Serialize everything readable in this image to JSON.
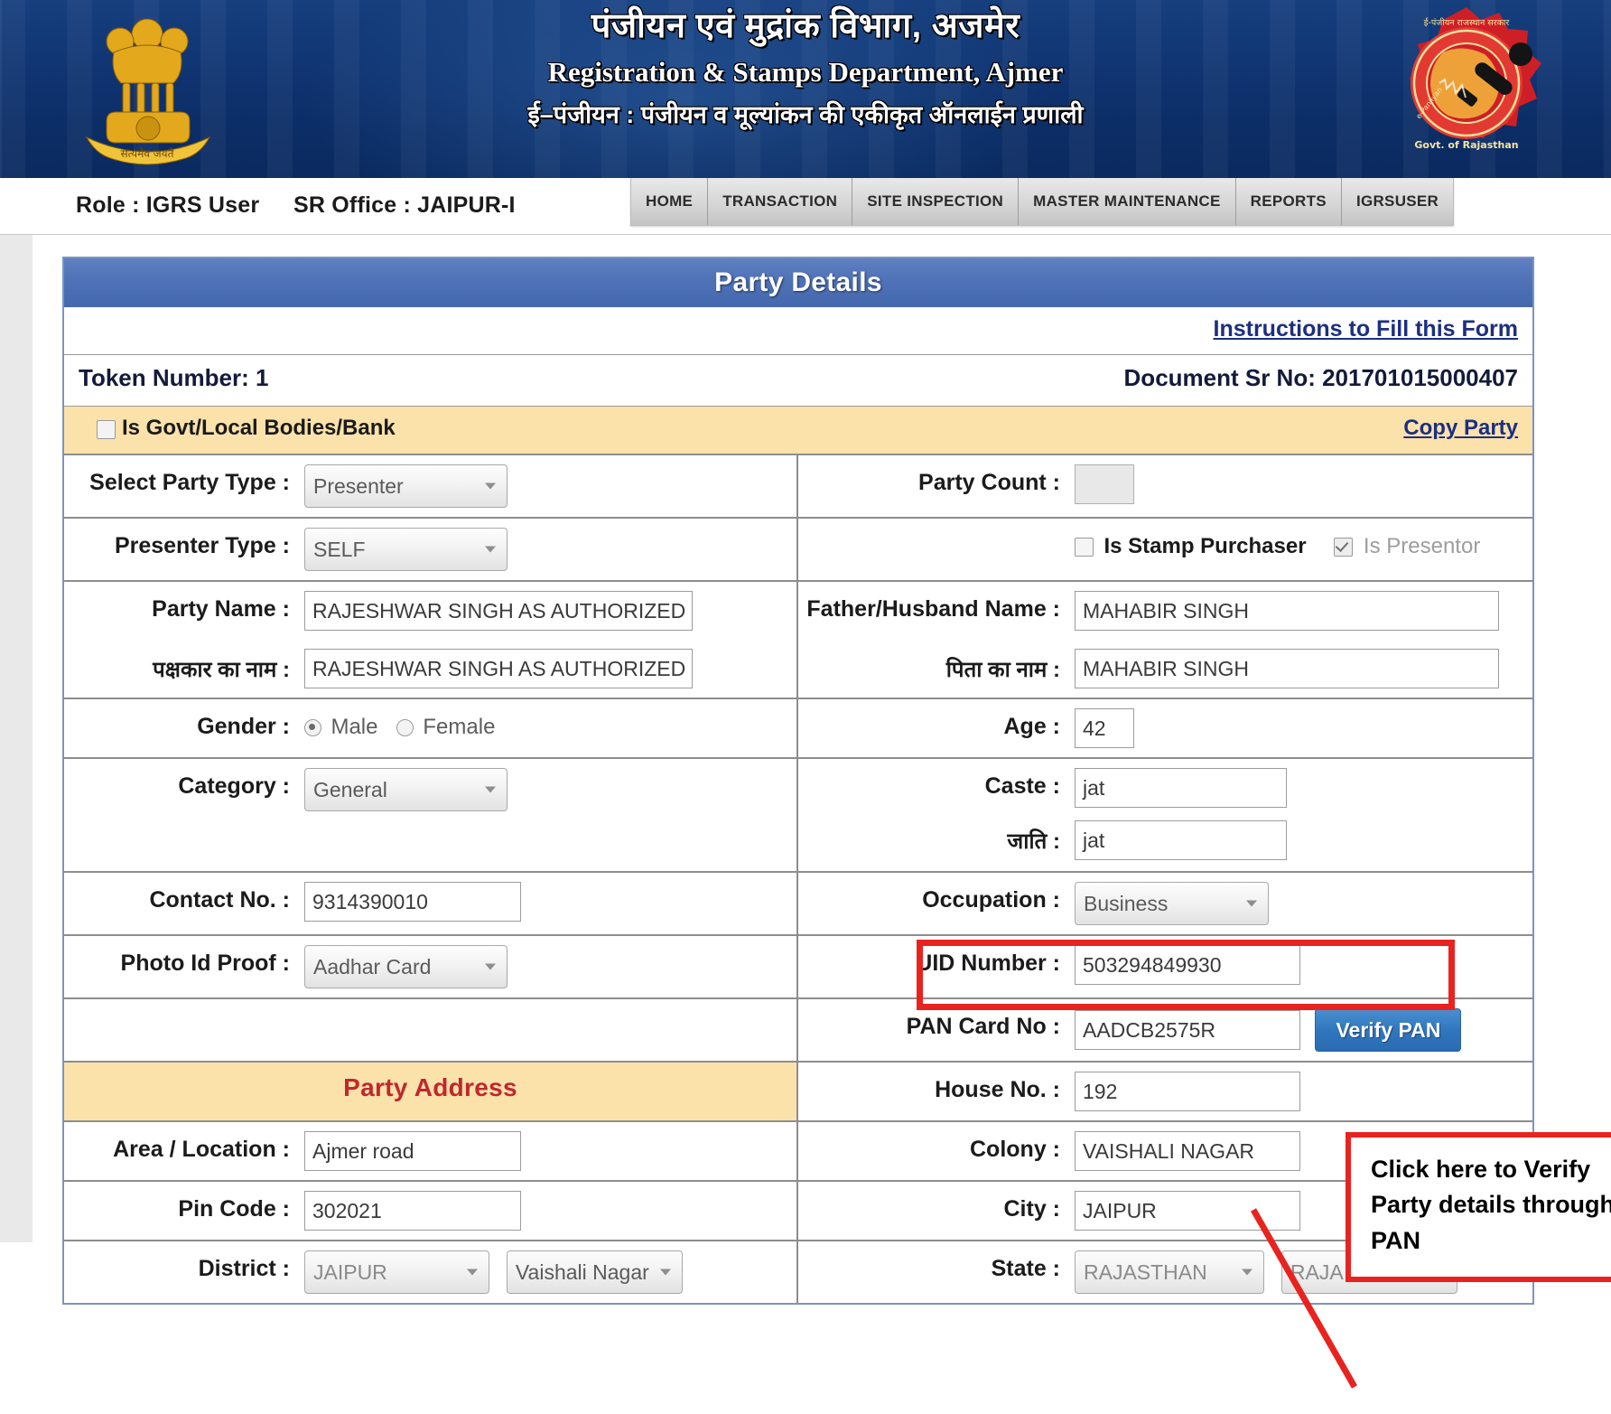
{
  "banner": {
    "title_hi": "पंजीयन एवं मुद्रांक विभाग, अजमेर",
    "title_en": "Registration & Stamps Department, Ajmer",
    "subtitle_hi": "ई–पंजीयन : पंजीयन व मूल्यांकन की एकीकृत ऑनलाईन प्रणाली",
    "emblem_icon": "ashoka-emblem-icon",
    "seal_icon": "rajasthan-govt-seal-icon"
  },
  "nav": {
    "role": "Role : IGRS User",
    "sr_office": "SR Office : JAIPUR-I",
    "items": [
      {
        "label": "HOME"
      },
      {
        "label": "TRANSACTION"
      },
      {
        "label": "SITE INSPECTION"
      },
      {
        "label": "MASTER MAINTENANCE"
      },
      {
        "label": "REPORTS"
      },
      {
        "label": "IGRSUSER"
      }
    ]
  },
  "panel": {
    "heading": "Party Details",
    "instructions_link": "Instructions to Fill this Form",
    "token_number": "Token Number: 1",
    "document_sr_no": "Document Sr No: 201701015000407",
    "govt_checkbox_label": "Is Govt/Local Bodies/Bank",
    "copy_party_link": "Copy Party"
  },
  "form": {
    "select_party_type": {
      "label": "Select Party Type :",
      "value": "Presenter"
    },
    "party_count": {
      "label": "Party Count :",
      "value": ""
    },
    "presenter_type": {
      "label": "Presenter Type :",
      "value": "SELF"
    },
    "is_stamp_purchaser": {
      "label": "Is Stamp Purchaser",
      "checked": false
    },
    "is_presentor": {
      "label": "Is Presentor",
      "checked": true
    },
    "party_name": {
      "label": "Party Name :",
      "value": "RAJESHWAR SINGH AS AUTHORIZED SIGNA"
    },
    "father_husband_name": {
      "label": "Father/Husband Name :",
      "value": "MAHABIR SINGH"
    },
    "party_name_hi": {
      "label": "पक्षकार का नाम :",
      "value": "RAJESHWAR SINGH AS AUTHORIZED SIGNA"
    },
    "father_name_hi": {
      "label": "पिता का नाम :",
      "value": "MAHABIR SINGH"
    },
    "gender": {
      "label": "Gender :",
      "male": "Male",
      "female": "Female",
      "selected": "Male"
    },
    "age": {
      "label": "Age :",
      "value": "42"
    },
    "category": {
      "label": "Category :",
      "value": "General"
    },
    "caste": {
      "label": "Caste :",
      "value": "jat"
    },
    "caste_hi": {
      "label": "जाति :",
      "value": "jat"
    },
    "contact_no": {
      "label": "Contact No. :",
      "value": "9314390010"
    },
    "occupation": {
      "label": "Occupation :",
      "value": "Business"
    },
    "photo_id_proof": {
      "label": "Photo Id Proof :",
      "value": "Aadhar Card"
    },
    "uid_number": {
      "label": "UID Number :",
      "value": "503294849930"
    },
    "pan_card_no": {
      "label": "PAN Card No :",
      "value": "AADCB2575R"
    },
    "verify_pan_button": "Verify PAN",
    "party_address_heading": "Party Address",
    "house_no": {
      "label": "House No. :",
      "value": "192"
    },
    "area_location": {
      "label": "Area / Location :",
      "value": "Ajmer road"
    },
    "colony": {
      "label": "Colony :",
      "value": "VAISHALI NAGAR"
    },
    "pin_code": {
      "label": "Pin Code :",
      "value": "302021"
    },
    "city": {
      "label": "City :",
      "value": "JAIPUR"
    },
    "district": {
      "label": "District :",
      "value": "JAIPUR",
      "sub_value": "Vaishali Nagar"
    },
    "state": {
      "label": "State :",
      "value": "RAJASTHAN",
      "sub_value": "RAJA"
    }
  },
  "annotation": {
    "line1": "Click here to Verify",
    "line2": "Party details through",
    "line3": "PAN",
    "highlight_color": "#e8231f"
  }
}
